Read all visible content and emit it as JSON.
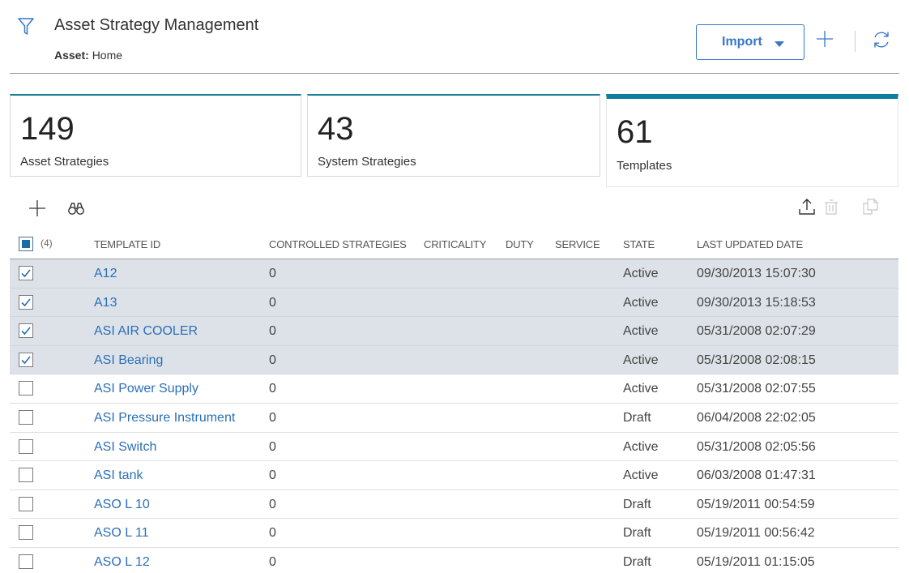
{
  "header": {
    "title": "Asset Strategy Management",
    "asset_label": "Asset:",
    "asset_value": "Home",
    "import_label": "Import"
  },
  "cards": [
    {
      "count": "149",
      "label": "Asset Strategies"
    },
    {
      "count": "43",
      "label": "System Strategies"
    },
    {
      "count": "61",
      "label": "Templates"
    }
  ],
  "colors": {
    "accent": "#3777c6",
    "tab_active": "#0e7ea0",
    "selected_row": "#dde2e8",
    "link": "#2a6fb8"
  },
  "grid": {
    "selected_count": "(4)",
    "columns": {
      "template_id": "TEMPLATE ID",
      "controlled": "CONTROLLED STRATEGIES",
      "criticality": "CRITICALITY",
      "duty": "DUTY",
      "service": "SERVICE",
      "state": "STATE",
      "updated": "LAST UPDATED DATE"
    },
    "rows": [
      {
        "id": "A12",
        "controlled": "0",
        "state": "Active",
        "updated": "09/30/2013 15:07:30",
        "checked": true
      },
      {
        "id": "A13",
        "controlled": "0",
        "state": "Active",
        "updated": "09/30/2013 15:18:53",
        "checked": true
      },
      {
        "id": "ASI AIR COOLER",
        "controlled": "0",
        "state": "Active",
        "updated": "05/31/2008 02:07:29",
        "checked": true
      },
      {
        "id": "ASI Bearing",
        "controlled": "0",
        "state": "Active",
        "updated": "05/31/2008 02:08:15",
        "checked": true
      },
      {
        "id": "ASI Power Supply",
        "controlled": "0",
        "state": "Active",
        "updated": "05/31/2008 02:07:55",
        "checked": false
      },
      {
        "id": "ASI Pressure Instrument",
        "controlled": "0",
        "state": "Draft",
        "updated": "06/04/2008 22:02:05",
        "checked": false
      },
      {
        "id": "ASI Switch",
        "controlled": "0",
        "state": "Active",
        "updated": "05/31/2008 02:05:56",
        "checked": false
      },
      {
        "id": "ASI tank",
        "controlled": "0",
        "state": "Active",
        "updated": "06/03/2008 01:47:31",
        "checked": false
      },
      {
        "id": "ASO L 10",
        "controlled": "0",
        "state": "Draft",
        "updated": "05/19/2011 00:54:59",
        "checked": false
      },
      {
        "id": "ASO L 11",
        "controlled": "0",
        "state": "Draft",
        "updated": "05/19/2011 00:56:42",
        "checked": false
      },
      {
        "id": "ASO L 12",
        "controlled": "0",
        "state": "Draft",
        "updated": "05/19/2011 01:15:05",
        "checked": false
      }
    ]
  }
}
